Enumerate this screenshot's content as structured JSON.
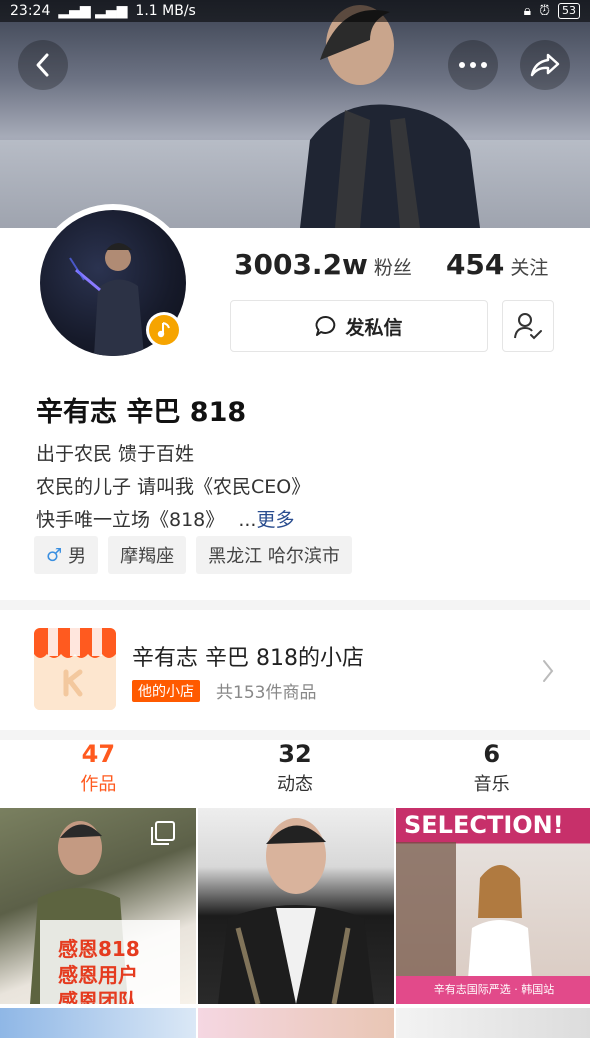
{
  "status_bar": {
    "time": "23:24",
    "signal": "▂▄▆ ▂▄▆",
    "speed": "1.1 MB/s",
    "battery": "53"
  },
  "header": {
    "back_icon": "chevron-left-icon",
    "more_icon": "more-dots-icon",
    "share_icon": "share-arrow-icon"
  },
  "profile": {
    "followers_count": "3003.2w",
    "followers_label": "粉丝",
    "following_count": "454",
    "following_label": "关注",
    "message_button": "发私信",
    "name": "辛有志 辛巴 818",
    "bio": [
      "出于农民 馈于百姓",
      "农民的儿子 请叫我《农民CEO》",
      "快手唯一立场《818》"
    ],
    "bio_more_prefix": "...",
    "bio_more": "更多",
    "tags": [
      "男",
      "摩羯座",
      "黑龙江 哈尔滨市"
    ]
  },
  "store": {
    "title": "辛有志 辛巴 818的小店",
    "badge": "他的小店",
    "count": "共153件商品"
  },
  "tabs": [
    {
      "count": "47",
      "label": "作品",
      "active": true
    },
    {
      "count": "32",
      "label": "动态",
      "active": false
    },
    {
      "count": "6",
      "label": "音乐",
      "active": false
    }
  ],
  "grid": {
    "cell1_lines": [
      "感恩818",
      "感恩用户",
      "感恩团队"
    ],
    "cell3_header": "SELECTION!",
    "cell3_caption": "辛有志国际严选 · 韩国站"
  },
  "colors": {
    "accent": "#ff5a1f",
    "store_badge": "#ff5a00",
    "link": "#2a4d8f",
    "music_badge": "#f6a400"
  }
}
